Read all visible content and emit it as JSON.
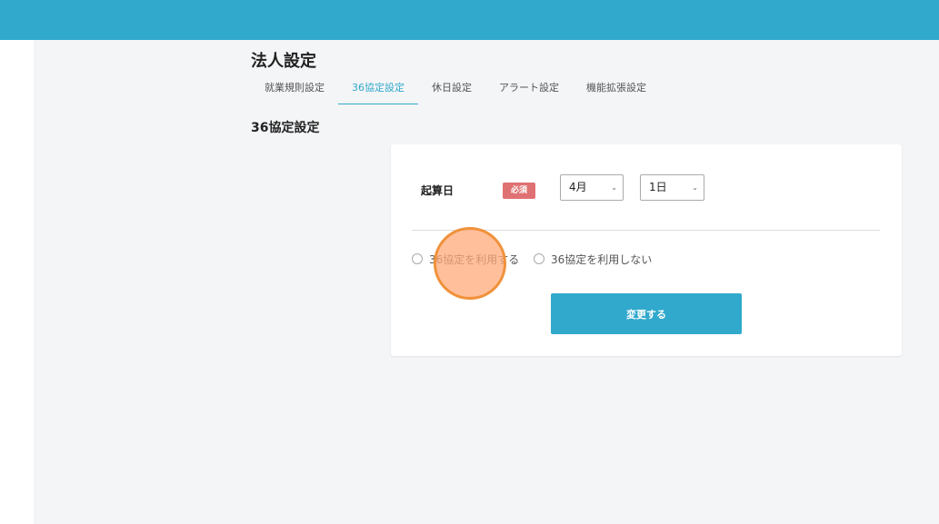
{
  "page": {
    "title": "法人設定"
  },
  "tabs": [
    {
      "label": "就業規則設定"
    },
    {
      "label": "36協定設定",
      "active": true
    },
    {
      "label": "休日設定"
    },
    {
      "label": "アラート設定"
    },
    {
      "label": "機能拡張設定"
    }
  ],
  "section": {
    "title": "36協定設定"
  },
  "form": {
    "start_date": {
      "label": "起算日",
      "required_badge": "必須",
      "month": {
        "value": "4月",
        "icon": "chevron-down-icon"
      },
      "day": {
        "value": "1日",
        "icon": "chevron-down-icon"
      }
    },
    "radios": [
      {
        "label": "36協定を利用する",
        "selected": false
      },
      {
        "label": "36協定を利用しない",
        "selected": false
      }
    ],
    "submit_label": "変更する"
  },
  "colors": {
    "accent": "#31a9cc",
    "required": "#e07172",
    "background": "#f4f5f7",
    "click_indicator": "#f0913a"
  }
}
